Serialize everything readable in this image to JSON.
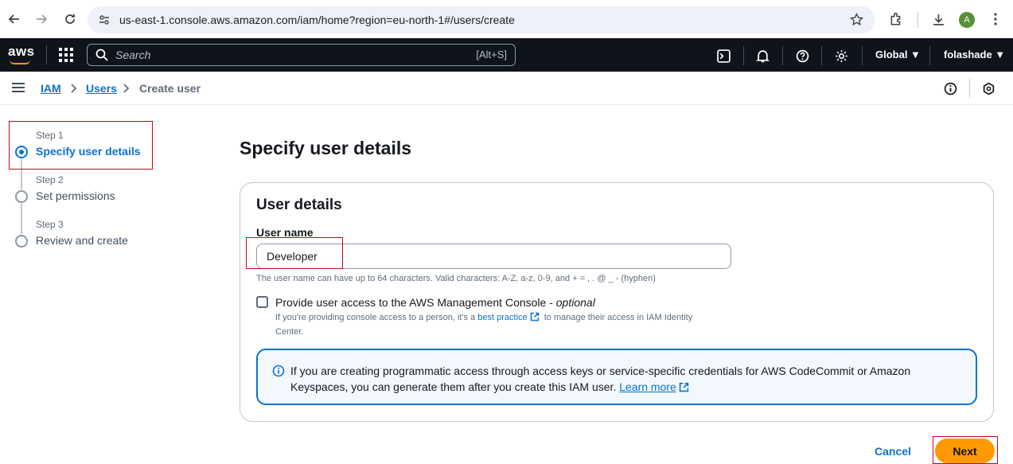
{
  "browser": {
    "url": "us-east-1.console.aws.amazon.com/iam/home?region=eu-north-1#/users/create",
    "avatar_letter": "A"
  },
  "aws_nav": {
    "logo": "aws",
    "search_placeholder": "Search",
    "search_shortcut": "[Alt+S]",
    "region": "Global ▼",
    "account": "folashade ▼"
  },
  "breadcrumb": {
    "items": [
      "IAM",
      "Users"
    ],
    "current": "Create user"
  },
  "steps": [
    {
      "small": "Step 1",
      "label": "Specify user details",
      "active": true
    },
    {
      "small": "Step 2",
      "label": "Set permissions",
      "active": false
    },
    {
      "small": "Step 3",
      "label": "Review and create",
      "active": false
    }
  ],
  "main": {
    "title": "Specify user details",
    "panel_title": "User details",
    "username_label": "User name",
    "username_value": "Developer",
    "username_hint": "The user name can have up to 64 characters. Valid characters: A-Z, a-z, 0-9, and + = , . @ _ - (hyphen)",
    "console_access_label": "Provide user access to the AWS Management Console - ",
    "console_access_optional": "optional",
    "console_desc_pre": "If you're providing console access to a person, it's a ",
    "console_desc_link": "best practice",
    "console_desc_post": " to manage their access in IAM Identity Center.",
    "info_text": "If you are creating programmatic access through access keys or service-specific credentials for AWS CodeCommit or Amazon Keyspaces, you can generate them after you create this IAM user. ",
    "info_link": "Learn more"
  },
  "actions": {
    "cancel": "Cancel",
    "next": "Next"
  },
  "colors": {
    "accent": "#0972d3",
    "primary_button": "#ff9900",
    "nav_bg": "#0f141a",
    "annotation_red": "#d0021b"
  }
}
